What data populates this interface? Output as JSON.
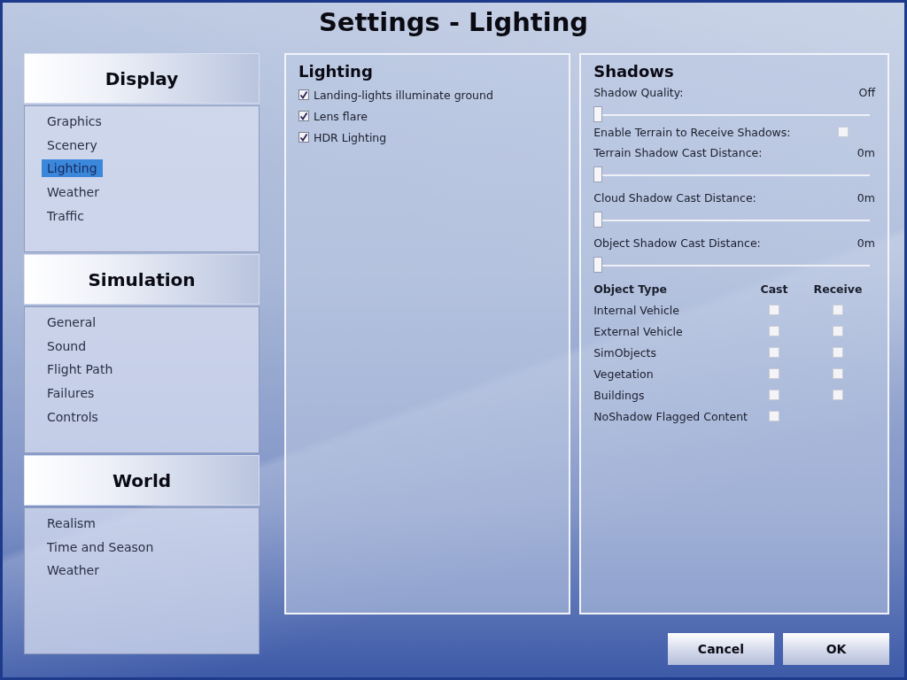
{
  "window": {
    "title": "Settings - Lighting"
  },
  "sidebar": {
    "sections": [
      {
        "title": "Display",
        "items": [
          {
            "label": "Graphics",
            "selected": false
          },
          {
            "label": "Scenery",
            "selected": false
          },
          {
            "label": "Lighting",
            "selected": true
          },
          {
            "label": "Weather",
            "selected": false
          },
          {
            "label": "Traffic",
            "selected": false
          }
        ]
      },
      {
        "title": "Simulation",
        "items": [
          {
            "label": "General",
            "selected": false
          },
          {
            "label": "Sound",
            "selected": false
          },
          {
            "label": "Flight Path",
            "selected": false
          },
          {
            "label": "Failures",
            "selected": false
          },
          {
            "label": "Controls",
            "selected": false
          }
        ]
      },
      {
        "title": "World",
        "items": [
          {
            "label": "Realism",
            "selected": false
          },
          {
            "label": "Time and Season",
            "selected": false
          },
          {
            "label": "Weather",
            "selected": false
          }
        ]
      }
    ]
  },
  "lighting": {
    "title": "Lighting",
    "options": [
      {
        "label": "Landing-lights illuminate ground",
        "checked": true
      },
      {
        "label": "Lens flare",
        "checked": true
      },
      {
        "label": "HDR Lighting",
        "checked": true
      }
    ]
  },
  "shadows": {
    "title": "Shadows",
    "settings": [
      {
        "kind": "slider",
        "label": "Shadow Quality:",
        "reading": "Off",
        "level": 0
      },
      {
        "kind": "checkbox",
        "label": "Enable Terrain to Receive Shadows:",
        "checked": false
      },
      {
        "kind": "slider",
        "label": "Terrain Shadow Cast Distance:",
        "reading": "0m",
        "level": 0
      },
      {
        "kind": "slider",
        "label": "Cloud Shadow Cast Distance:",
        "reading": "0m",
        "level": 0
      },
      {
        "kind": "slider",
        "label": "Object Shadow Cast Distance:",
        "reading": "0m",
        "level": 0
      }
    ],
    "object_table": {
      "columns": [
        "Object Type",
        "Cast",
        "Receive"
      ],
      "rows": [
        {
          "name": "Internal Vehicle",
          "cast": false,
          "receive": false
        },
        {
          "name": "External Vehicle",
          "cast": false,
          "receive": false
        },
        {
          "name": "SimObjects",
          "cast": false,
          "receive": false
        },
        {
          "name": "Vegetation",
          "cast": false,
          "receive": false
        },
        {
          "name": "Buildings",
          "cast": false,
          "receive": false
        },
        {
          "name": "NoShadow Flagged Content",
          "cast": false
        }
      ]
    }
  },
  "buttons": [
    {
      "label": "Cancel"
    },
    {
      "label": "OK"
    }
  ]
}
